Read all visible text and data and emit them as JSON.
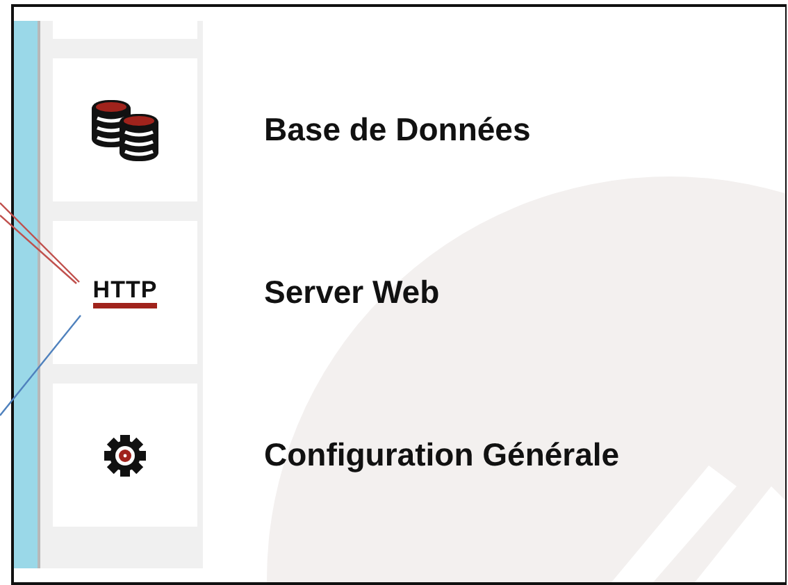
{
  "menu_items": [
    {
      "kind": "database",
      "label": "Base de Données"
    },
    {
      "kind": "http",
      "icon_text": "HTTP",
      "label": "Server Web"
    },
    {
      "kind": "gear",
      "label": "Configuration Générale"
    }
  ]
}
